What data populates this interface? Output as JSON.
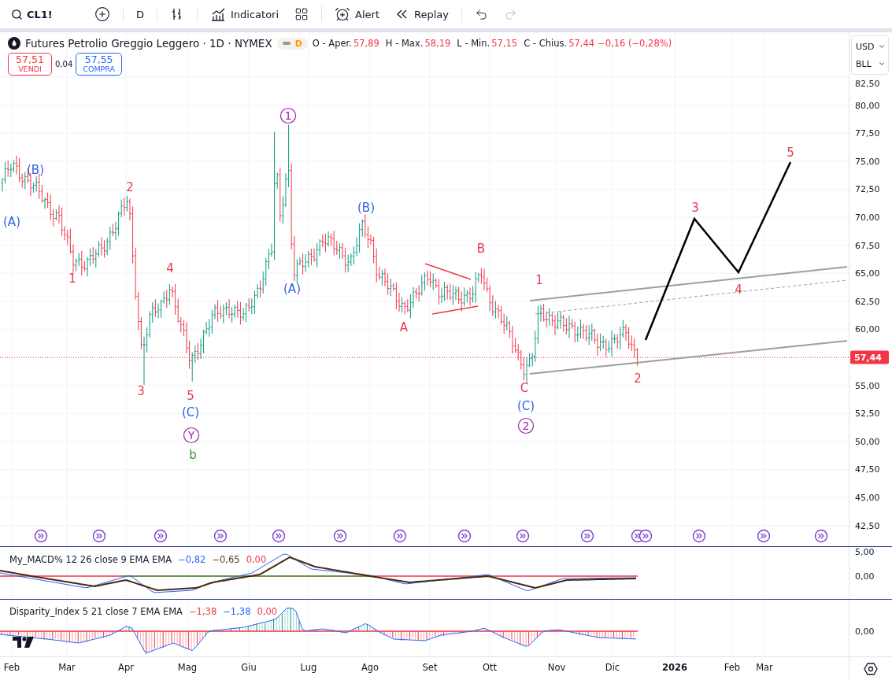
{
  "toolbar": {
    "symbol": "CL1!",
    "interval": "D",
    "indicators": "Indicatori",
    "alert": "Alert",
    "replay": "Replay",
    "redo_disabled": true
  },
  "legend": {
    "title": "Futures Petrolio Greggio Leggero · 1D · NYMEX",
    "status_letter": "D",
    "ohlc": [
      {
        "label": "O - Aper.",
        "value": "57,89",
        "color": "#f23645"
      },
      {
        "label": "H - Max.",
        "value": "58,19",
        "color": "#f23645"
      },
      {
        "label": "L - Min.",
        "value": "57,15",
        "color": "#f23645"
      },
      {
        "label": "C - Chius.",
        "value": "57,44",
        "color": "#f23645"
      },
      {
        "value": "−0,16 (−0,28%)",
        "color": "#f23645"
      }
    ]
  },
  "trade": {
    "sell_price": "57,51",
    "sell_label": "VENDI",
    "spread": "0,04",
    "buy_price": "57,55",
    "buy_label": "COMPRA"
  },
  "currency": "USD",
  "unit": "BLL",
  "price_axis": [
    "82,50",
    "80,00",
    "77,50",
    "75,00",
    "72,50",
    "70,00",
    "67,50",
    "65,00",
    "62,50",
    "60,00",
    "55,00",
    "52,50",
    "50,00",
    "47,50",
    "45,00",
    "42,50"
  ],
  "last_price": "57,44",
  "wave_labels": [
    {
      "text": "(B)",
      "color": "#2f5fe0",
      "kind": "plain"
    },
    {
      "text": "(A)",
      "color": "#2f5fe0",
      "kind": "plain"
    },
    {
      "text": "1",
      "color": "#e5394b",
      "kind": "plain"
    },
    {
      "text": "2",
      "color": "#e5394b",
      "kind": "plain"
    },
    {
      "text": "4",
      "color": "#e5394b",
      "kind": "plain"
    },
    {
      "text": "3",
      "color": "#e5394b",
      "kind": "plain"
    },
    {
      "text": "5",
      "color": "#e5394b",
      "kind": "plain"
    },
    {
      "text": "(C)",
      "color": "#2f5fe0",
      "kind": "plain"
    },
    {
      "text": "Y",
      "color": "#9c27b0",
      "kind": "circled"
    },
    {
      "text": "b",
      "color": "#388e3c",
      "kind": "plain"
    },
    {
      "text": "1",
      "color": "#9c27b0",
      "kind": "circled"
    },
    {
      "text": "(A)",
      "color": "#2f5fe0",
      "kind": "plain"
    },
    {
      "text": "(B)",
      "color": "#2f5fe0",
      "kind": "plain"
    },
    {
      "text": "A",
      "color": "#e5394b",
      "kind": "plain"
    },
    {
      "text": "B",
      "color": "#e5394b",
      "kind": "plain"
    },
    {
      "text": "1",
      "color": "#e5394b",
      "kind": "plain"
    },
    {
      "text": "C",
      "color": "#e5394b",
      "kind": "plain"
    },
    {
      "text": "(C)",
      "color": "#2f5fe0",
      "kind": "plain"
    },
    {
      "text": "2",
      "color": "#9c27b0",
      "kind": "circled"
    },
    {
      "text": "2",
      "color": "#e5394b",
      "kind": "plain"
    },
    {
      "text": "3",
      "color": "#e5394b",
      "kind": "plain"
    },
    {
      "text": "4",
      "color": "#e5394b",
      "kind": "plain"
    },
    {
      "text": "5",
      "color": "#e5394b",
      "kind": "plain"
    }
  ],
  "macd": {
    "title": "My_MACD% 12 26 close 9 EMA EMA",
    "values": [
      {
        "text": "−0,82",
        "color": "#2962ff"
      },
      {
        "text": "−0,65",
        "color": "#5d3a1a"
      },
      {
        "text": "0,00",
        "color": "#f23645"
      }
    ],
    "axis": [
      "5,00",
      "0,00"
    ]
  },
  "disparity": {
    "title": "Disparity_Index 5 21 close 7 EMA EMA",
    "values": [
      {
        "text": "−1,38",
        "color": "#f23645"
      },
      {
        "text": "−1,38",
        "color": "#2962ff"
      },
      {
        "text": "0,00",
        "color": "#f23645"
      }
    ],
    "axis": [
      "0,00"
    ]
  },
  "time_axis": [
    {
      "label": "Feb",
      "kind": "month"
    },
    {
      "label": "Mar",
      "kind": "month"
    },
    {
      "label": "Apr",
      "kind": "month"
    },
    {
      "label": "Mag",
      "kind": "month"
    },
    {
      "label": "Giu",
      "kind": "month"
    },
    {
      "label": "Lug",
      "kind": "month"
    },
    {
      "label": "Ago",
      "kind": "month"
    },
    {
      "label": "Set",
      "kind": "month"
    },
    {
      "label": "Ott",
      "kind": "month"
    },
    {
      "label": "Nov",
      "kind": "month"
    },
    {
      "label": "Dic",
      "kind": "month"
    },
    {
      "label": "2026",
      "kind": "year"
    },
    {
      "label": "Feb",
      "kind": "month"
    },
    {
      "label": "Mar",
      "kind": "month"
    }
  ]
}
